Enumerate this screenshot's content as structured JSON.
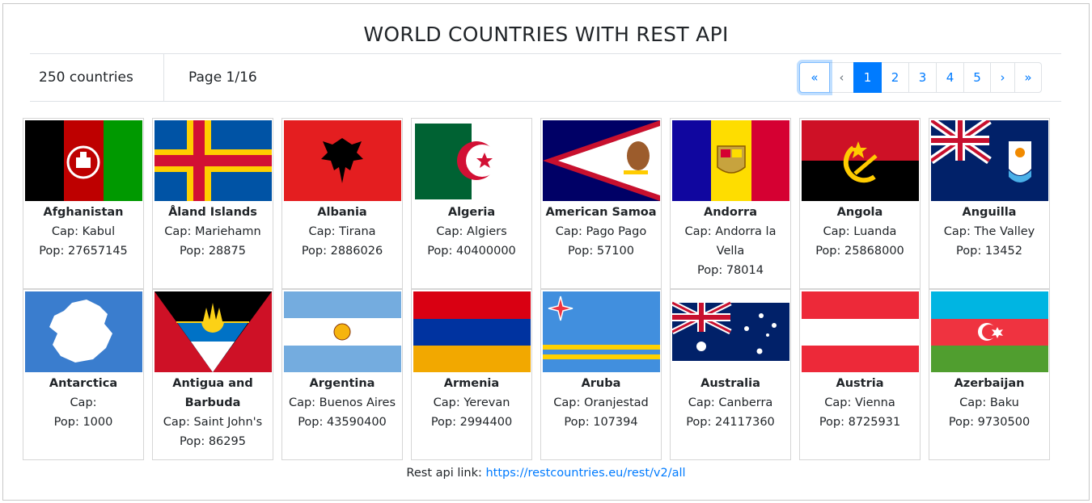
{
  "title": "WORLD COUNTRIES WITH REST API",
  "summary": {
    "count_label": "250 countries",
    "page_label": "Page 1/16"
  },
  "pagination": {
    "first": "«",
    "prev": "‹",
    "pages": [
      "1",
      "2",
      "3",
      "4",
      "5"
    ],
    "next": "›",
    "last": "»",
    "active": "1"
  },
  "countries": [
    {
      "flag": "afghanistan-flag",
      "name": "Afghanistan",
      "cap": "Cap: Kabul",
      "pop": "Pop: 27657145"
    },
    {
      "flag": "aland-islands-flag",
      "name": "Åland Islands",
      "cap": "Cap: Mariehamn",
      "pop": "Pop: 28875"
    },
    {
      "flag": "albania-flag",
      "name": "Albania",
      "cap": "Cap: Tirana",
      "pop": "Pop: 2886026"
    },
    {
      "flag": "algeria-flag",
      "name": "Algeria",
      "cap": "Cap: Algiers",
      "pop": "Pop: 40400000"
    },
    {
      "flag": "american-samoa-flag",
      "name": "American Samoa",
      "cap": "Cap: Pago Pago",
      "pop": "Pop: 57100"
    },
    {
      "flag": "andorra-flag",
      "name": "Andorra",
      "cap": "Cap: Andorra la Vella",
      "pop": "Pop: 78014"
    },
    {
      "flag": "angola-flag",
      "name": "Angola",
      "cap": "Cap: Luanda",
      "pop": "Pop: 25868000"
    },
    {
      "flag": "anguilla-flag",
      "name": "Anguilla",
      "cap": "Cap: The Valley",
      "pop": "Pop: 13452"
    },
    {
      "flag": "antarctica-flag",
      "name": "Antarctica",
      "cap": "Cap:",
      "pop": "Pop: 1000"
    },
    {
      "flag": "antigua-and-barbuda-flag",
      "name": "Antigua and Barbuda",
      "cap": "Cap: Saint John's",
      "pop": "Pop: 86295"
    },
    {
      "flag": "argentina-flag",
      "name": "Argentina",
      "cap": "Cap: Buenos Aires",
      "pop": "Pop: 43590400"
    },
    {
      "flag": "armenia-flag",
      "name": "Armenia",
      "cap": "Cap: Yerevan",
      "pop": "Pop: 2994400"
    },
    {
      "flag": "aruba-flag",
      "name": "Aruba",
      "cap": "Cap: Oranjestad",
      "pop": "Pop: 107394"
    },
    {
      "flag": "australia-flag",
      "name": "Australia",
      "cap": "Cap: Canberra",
      "pop": "Pop: 24117360"
    },
    {
      "flag": "austria-flag",
      "name": "Austria",
      "cap": "Cap: Vienna",
      "pop": "Pop: 8725931"
    },
    {
      "flag": "azerbaijan-flag",
      "name": "Azerbaijan",
      "cap": "Cap: Baku",
      "pop": "Pop: 9730500"
    }
  ],
  "footer": {
    "label": "Rest api link: ",
    "link_text": "https://restcountries.eu/rest/v2/all"
  },
  "colors": {
    "accent": "#007bff",
    "border": "#dee2e6"
  }
}
